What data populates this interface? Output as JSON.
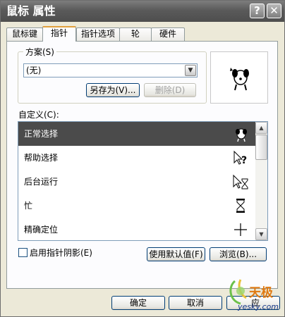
{
  "window": {
    "title": "鼠标 属性",
    "help_glyph": "?",
    "close_glyph": "✕"
  },
  "tabs": [
    {
      "label": "鼠标键",
      "active": false
    },
    {
      "label": "指针",
      "active": true
    },
    {
      "label": "指针选项",
      "active": false
    },
    {
      "label": "轮",
      "active": false
    },
    {
      "label": "硬件",
      "active": false
    }
  ],
  "scheme": {
    "group_label": "方案(S)",
    "selected": "(无)",
    "save_as_label": "另存为(V)...",
    "delete_label": "删除(D)"
  },
  "custom": {
    "label": "自定义(C):",
    "items": [
      {
        "label": "正常选择",
        "icon": "dog-cursor-icon",
        "selected": true
      },
      {
        "label": "帮助选择",
        "icon": "help-cursor-icon",
        "selected": false
      },
      {
        "label": "后台运行",
        "icon": "busy-arrow-cursor-icon",
        "selected": false
      },
      {
        "label": "忙",
        "icon": "hourglass-icon",
        "selected": false
      },
      {
        "label": "精确定位",
        "icon": "crosshair-icon",
        "selected": false
      }
    ]
  },
  "options": {
    "shadow_label": "启用指针阴影(E)",
    "shadow_checked": false,
    "default_label": "使用默认值(F)",
    "browse_label": "浏览(B)..."
  },
  "footer": {
    "ok_label": "确定",
    "cancel_label": "取消",
    "apply_label": "应"
  },
  "watermark": {
    "brand": "天极",
    "site": "yesky.com"
  }
}
